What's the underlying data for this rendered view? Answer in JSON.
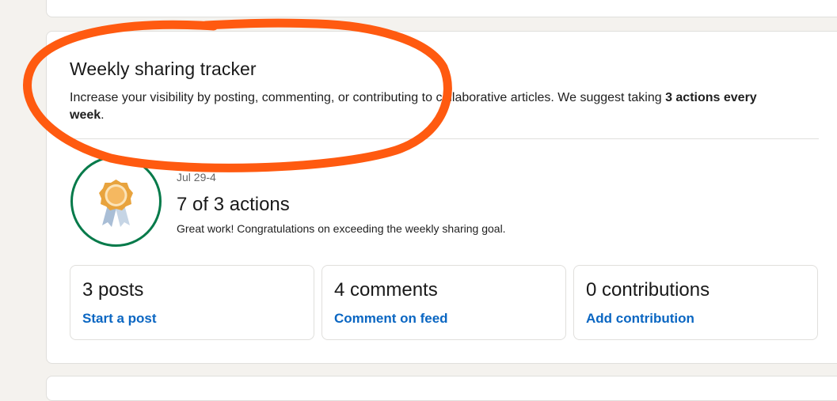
{
  "tracker": {
    "title": "Weekly sharing tracker",
    "description_prefix": "Increase your visibility by posting, commenting, or contributing to collaborative articles. We suggest taking ",
    "description_bold": "3 actions every week",
    "description_suffix": ".",
    "date_range": "Jul 29-4",
    "actions_count": "7 of 3",
    "actions_word": " actions",
    "congrats": "Great work! Congratulations on exceeding the weekly sharing goal."
  },
  "stats": [
    {
      "count": "3",
      "label": " posts",
      "link": "Start a post"
    },
    {
      "count": "4",
      "label": " comments",
      "link": "Comment on feed"
    },
    {
      "count": "0",
      "label": " contributions",
      "link": "Add contribution"
    }
  ],
  "colors": {
    "badge_ring": "#067a4a",
    "link": "#0a66c2",
    "annotation": "#ff5a10"
  }
}
